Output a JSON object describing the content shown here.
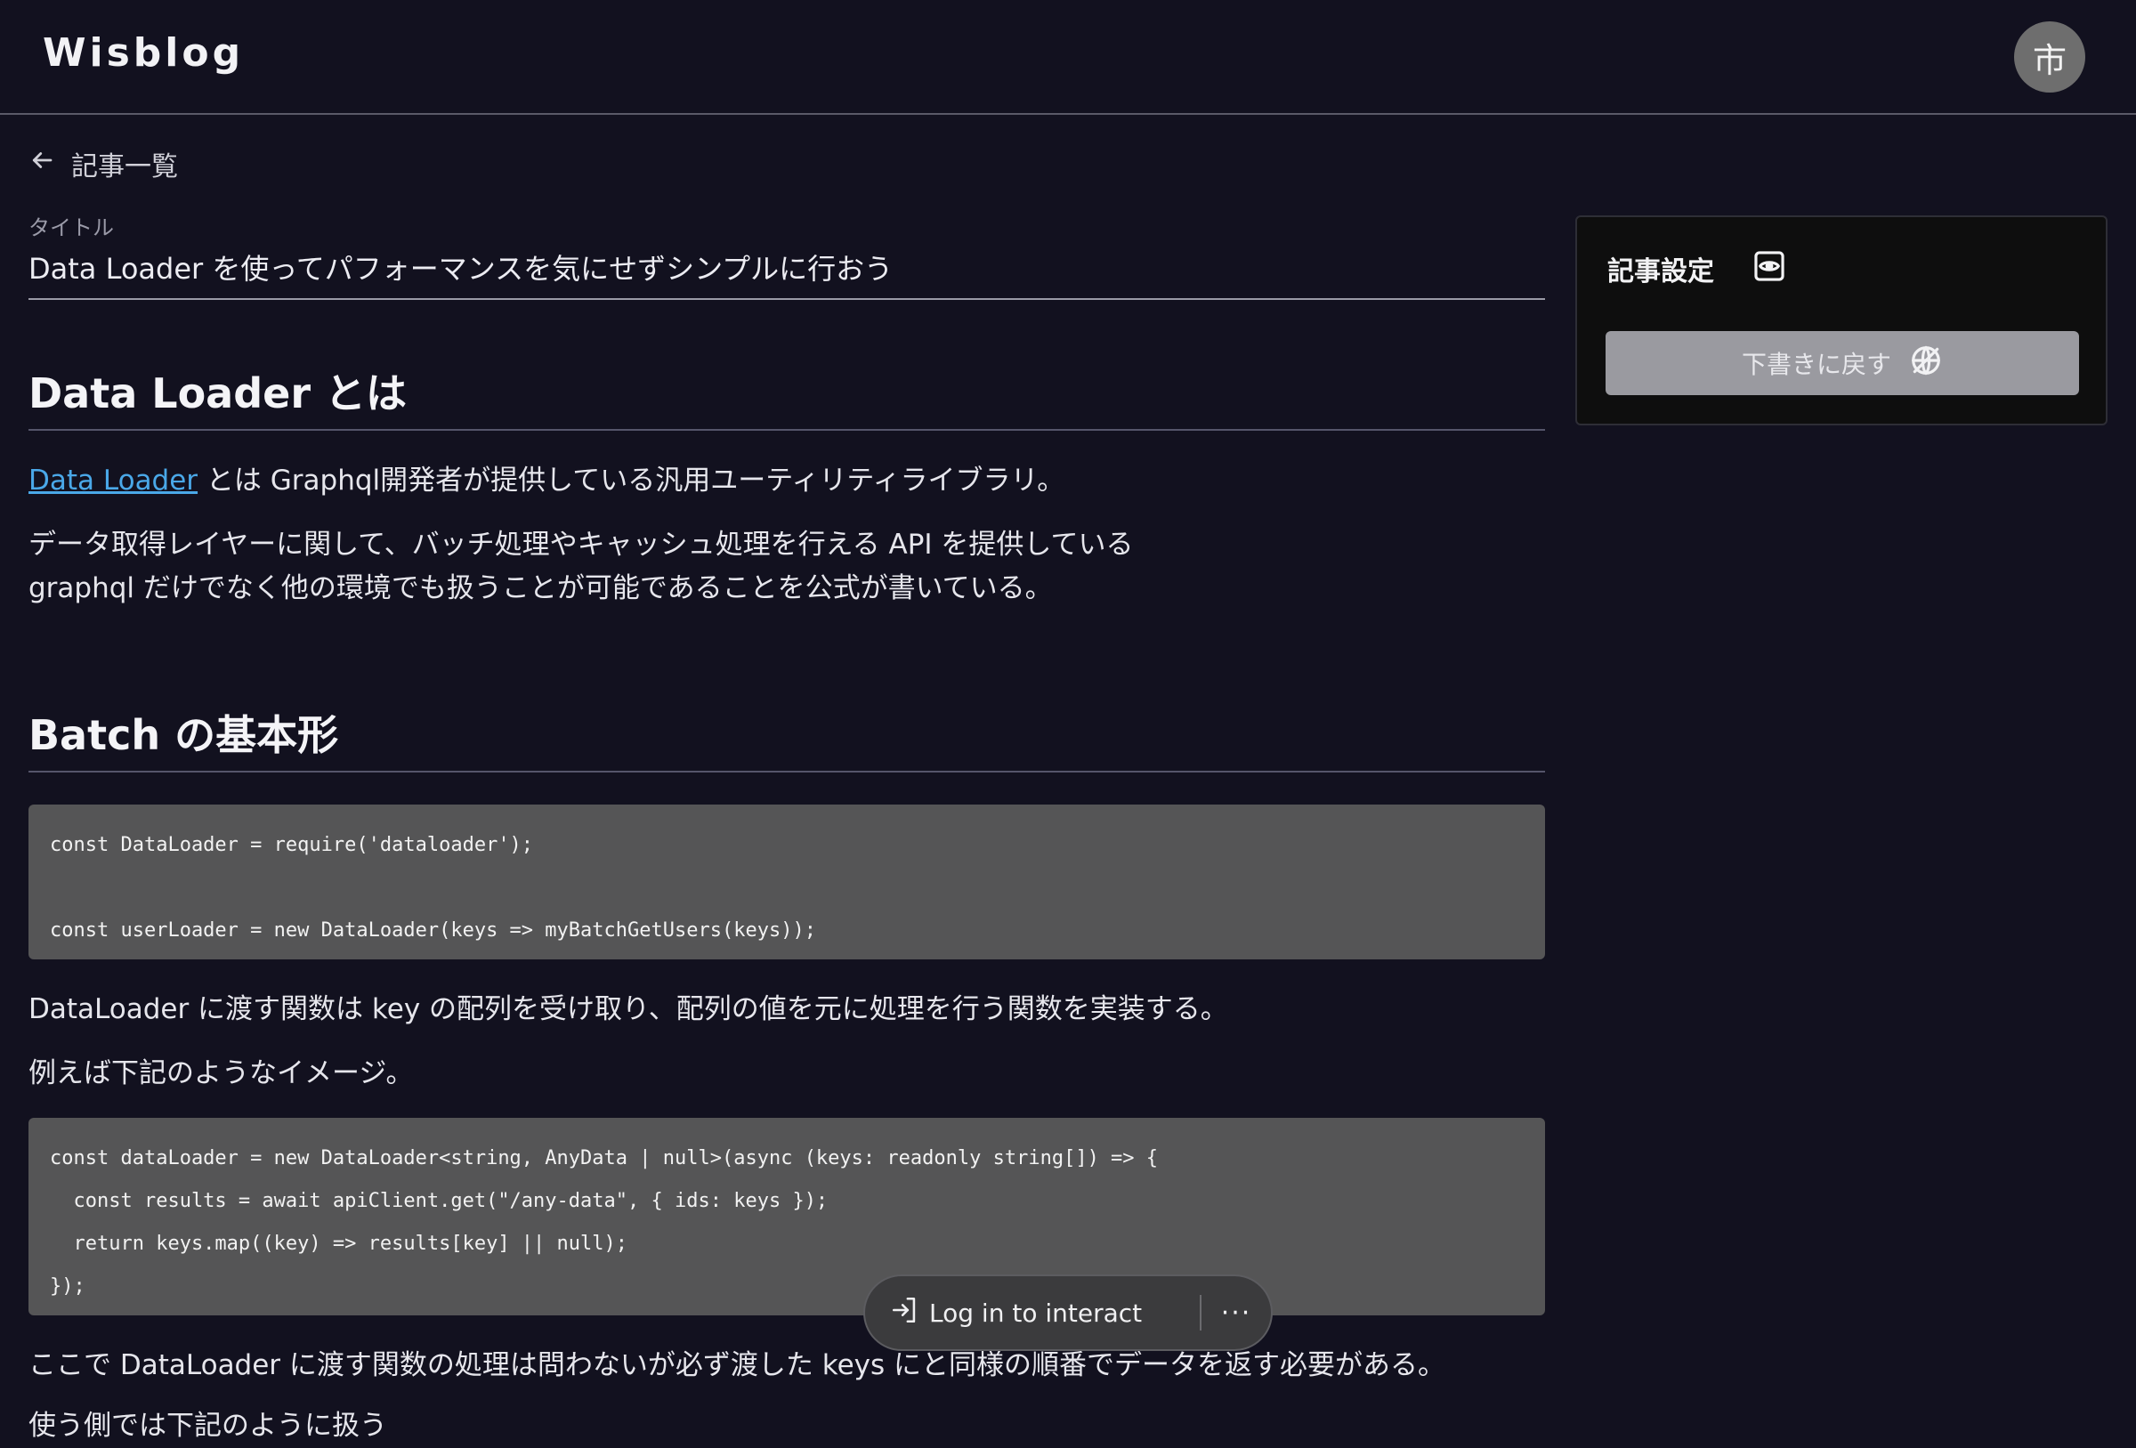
{
  "header": {
    "logo": "Wisblog",
    "avatar_text": "市"
  },
  "nav": {
    "back_label": "記事一覧"
  },
  "editor": {
    "title_label": "タイトル",
    "title_value": "Data Loader を使ってパフォーマンスを気にせずシンプルに行おう"
  },
  "article": {
    "h2_1": "Data Loader とは",
    "p1_link": "Data Loader",
    "p1_rest": " とは Graphql開発者が提供している汎用ユーティリティライブラリ。",
    "p2_line1": "データ取得レイヤーに関して、バッチ処理やキャッシュ処理を行える API を提供している",
    "p2_line2": "graphql だけでなく他の環境でも扱うことが可能であることを公式が書いている。",
    "h2_2": "Batch の基本形",
    "code1": [
      "const DataLoader = require('dataloader');",
      "",
      "const userLoader = new DataLoader(keys => myBatchGetUsers(keys));"
    ],
    "p3": "DataLoader に渡す関数は key の配列を受け取り、配列の値を元に処理を行う関数を実装する。",
    "p4": "例えば下記のようなイメージ。",
    "code2": [
      "const dataLoader = new DataLoader<string, AnyData | null>(async (keys: readonly string[]) => {",
      "  const results = await apiClient.get(\"/any-data\", { ids: keys });",
      "  return keys.map((key) => results[key] || null);",
      "});"
    ],
    "p5": "ここで DataLoader に渡す関数の処理は問わないが必ず渡した keys にと同様の順番でデータを返す必要がある。",
    "p6": "使う側では下記のように扱う"
  },
  "settings": {
    "title": "記事設定",
    "draft_button": "下書きに戻す"
  },
  "overlay": {
    "login_label": "Log in to interact",
    "more_label": "···"
  }
}
